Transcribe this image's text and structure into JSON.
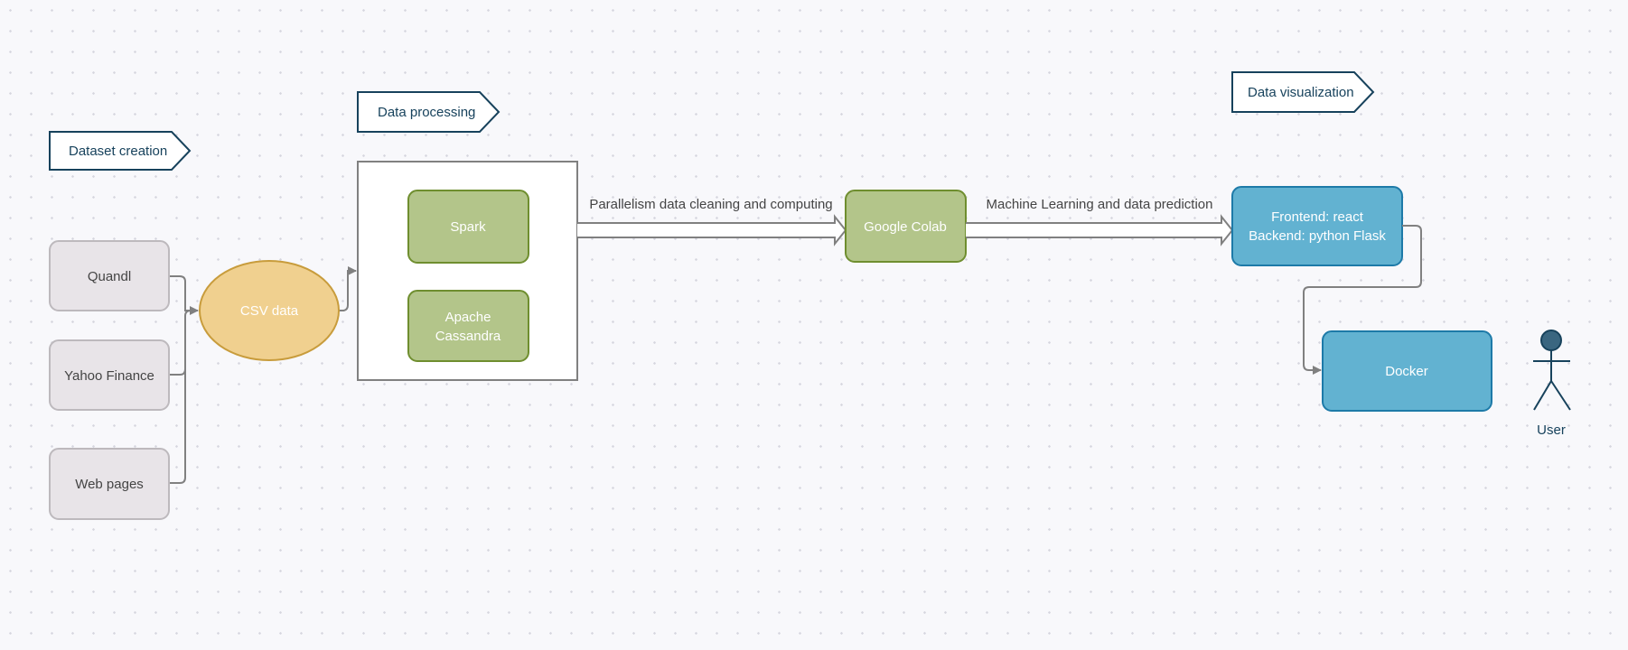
{
  "stages": {
    "dataset_creation": "Dataset creation",
    "data_processing": "Data processing",
    "data_visualization": "Data visualization"
  },
  "sources": [
    "Quandl",
    "Yahoo Finance",
    "Web pages"
  ],
  "csv": "CSV data",
  "processing": {
    "spark": "Spark",
    "cassandra_line1": "Apache",
    "cassandra_line2": "Cassandra"
  },
  "colab": "Google Colab",
  "edges": {
    "processing_to_colab": "Parallelism data cleaning and computing",
    "colab_to_frontend": "Machine Learning and data prediction"
  },
  "frontend": {
    "line1": "Frontend: react",
    "line2": "Backend: python Flask"
  },
  "docker": "Docker",
  "actor": "User",
  "colors": {
    "source_fill": "#e8e4e8",
    "csv_fill": "#f0d08f",
    "green_fill": "#b3c58a",
    "blue_fill": "#62b2d1",
    "tag_border": "#17425c",
    "connector": "#808080"
  }
}
